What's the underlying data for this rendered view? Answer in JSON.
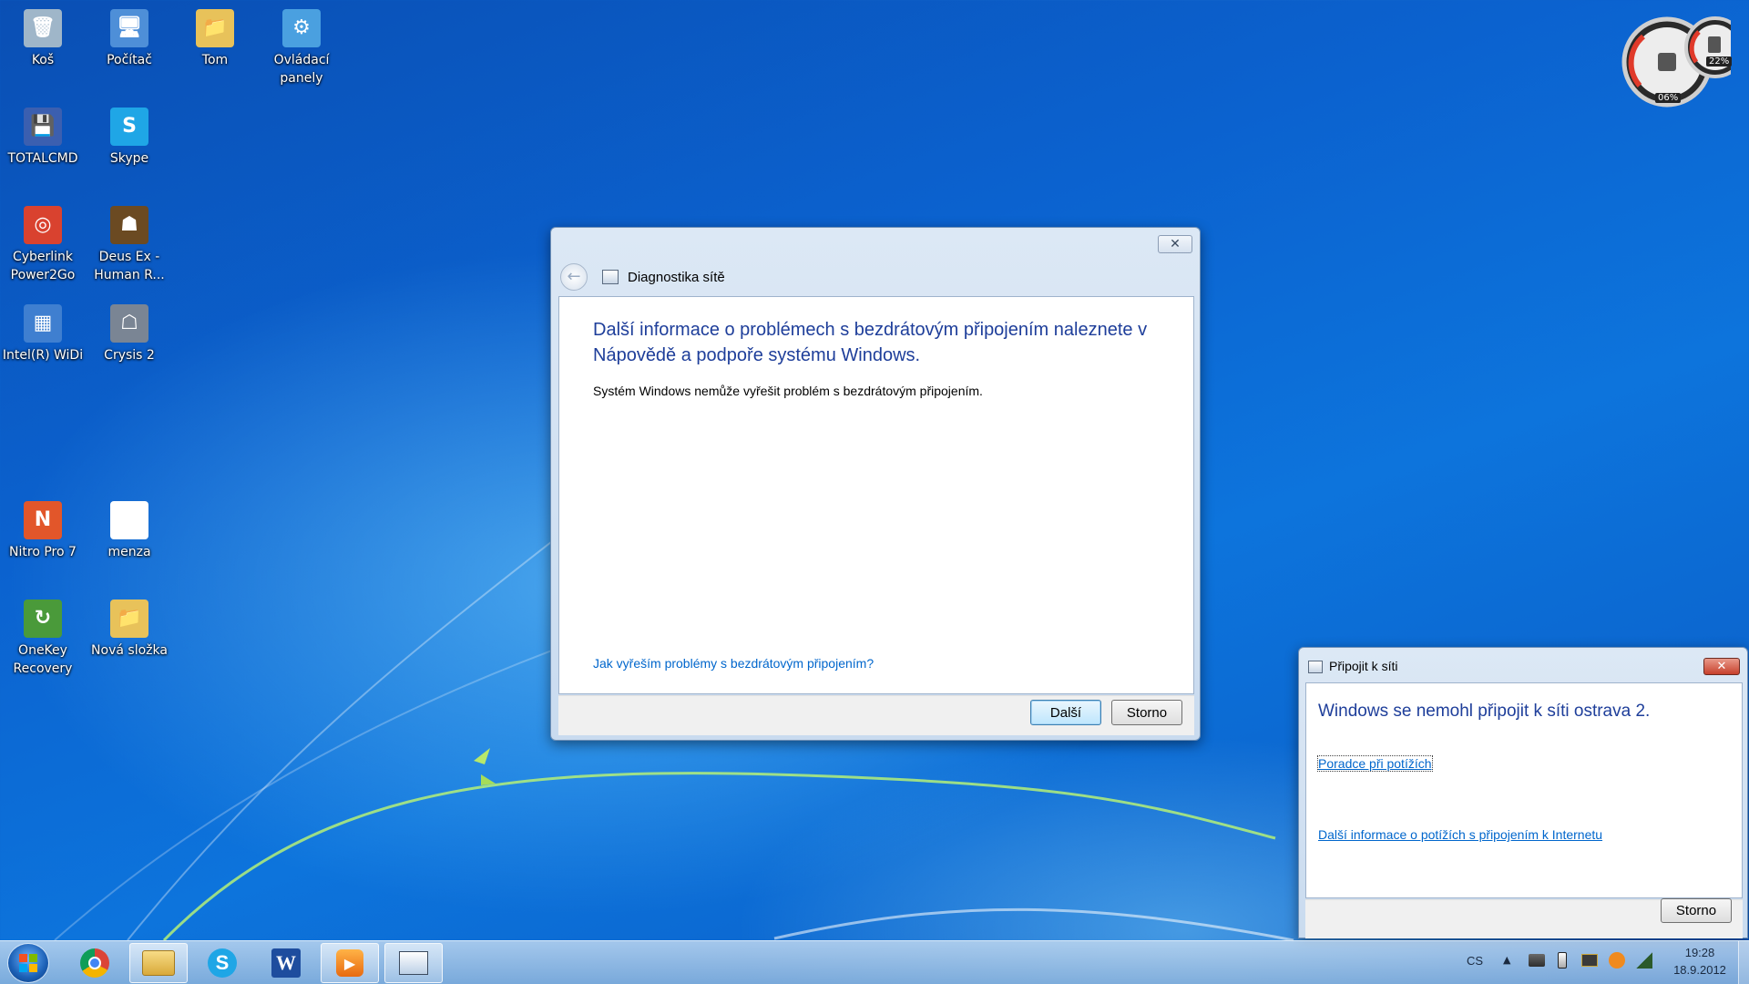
{
  "desktop": {
    "icons": [
      {
        "label": "Koš",
        "glyph": "🗑",
        "color": "#9fb6c9"
      },
      {
        "label": "Počítač",
        "glyph": "🖥",
        "color": "#4e8fd8"
      },
      {
        "label": "Tom",
        "glyph": "📁",
        "color": "#e8c25a"
      },
      {
        "label": "Ovládací\npanely",
        "glyph": "⚙",
        "color": "#4aa0e0"
      },
      {
        "label": "TOTALCMD",
        "glyph": "💾",
        "color": "#3b5fb0"
      },
      {
        "label": "Skype",
        "glyph": "S",
        "color": "#1fa6e6"
      },
      {
        "label": "Cyberlink\nPower2Go",
        "glyph": "◎",
        "color": "#d9422f"
      },
      {
        "label": "Deus Ex -\nHuman R...",
        "glyph": "☗",
        "color": "#6b4a22"
      },
      {
        "label": "Intel(R) WiDi",
        "glyph": "▦",
        "color": "#3f7fd0"
      },
      {
        "label": "Crysis 2",
        "glyph": "☖",
        "color": "#7a8594"
      },
      {
        "label": "Nitro Pro 7",
        "glyph": "N",
        "color": "#e2562a"
      },
      {
        "label": "menza",
        "glyph": "",
        "color": "#ffffff"
      },
      {
        "label": "OneKey\nRecovery",
        "glyph": "↻",
        "color": "#4a9a3a"
      },
      {
        "label": "Nová složka",
        "glyph": "📁",
        "color": "#e8c25a"
      }
    ]
  },
  "gadget": {
    "cpu_percent": "06%",
    "memory_percent": "22%"
  },
  "diag_window": {
    "title": "Diagnostika sítě",
    "heading": "Další informace o problémech s bezdrátovým připojením naleznete v Nápovědě a podpoře systému Windows.",
    "body": "Systém Windows nemůže vyřešit problém s bezdrátovým připojením.",
    "help_link": "Jak vyřeším problémy s bezdrátovým připojením?",
    "next_label": "Další",
    "cancel_label": "Storno"
  },
  "connect_window": {
    "title": "Připojit k síti",
    "heading": "Windows se nemohl připojit k síti ostrava 2.",
    "troubleshoot_link": "Poradce při potížích",
    "more_info_link": "Další informace o potížích s připojením k Internetu",
    "cancel_label": "Storno"
  },
  "taskbar": {
    "language": "CS",
    "time": "19:28",
    "date": "18.9.2012"
  },
  "colors": {
    "heading_blue": "#1e3e9a",
    "link_blue": "#0066cc",
    "close_red": "#c7402c"
  }
}
